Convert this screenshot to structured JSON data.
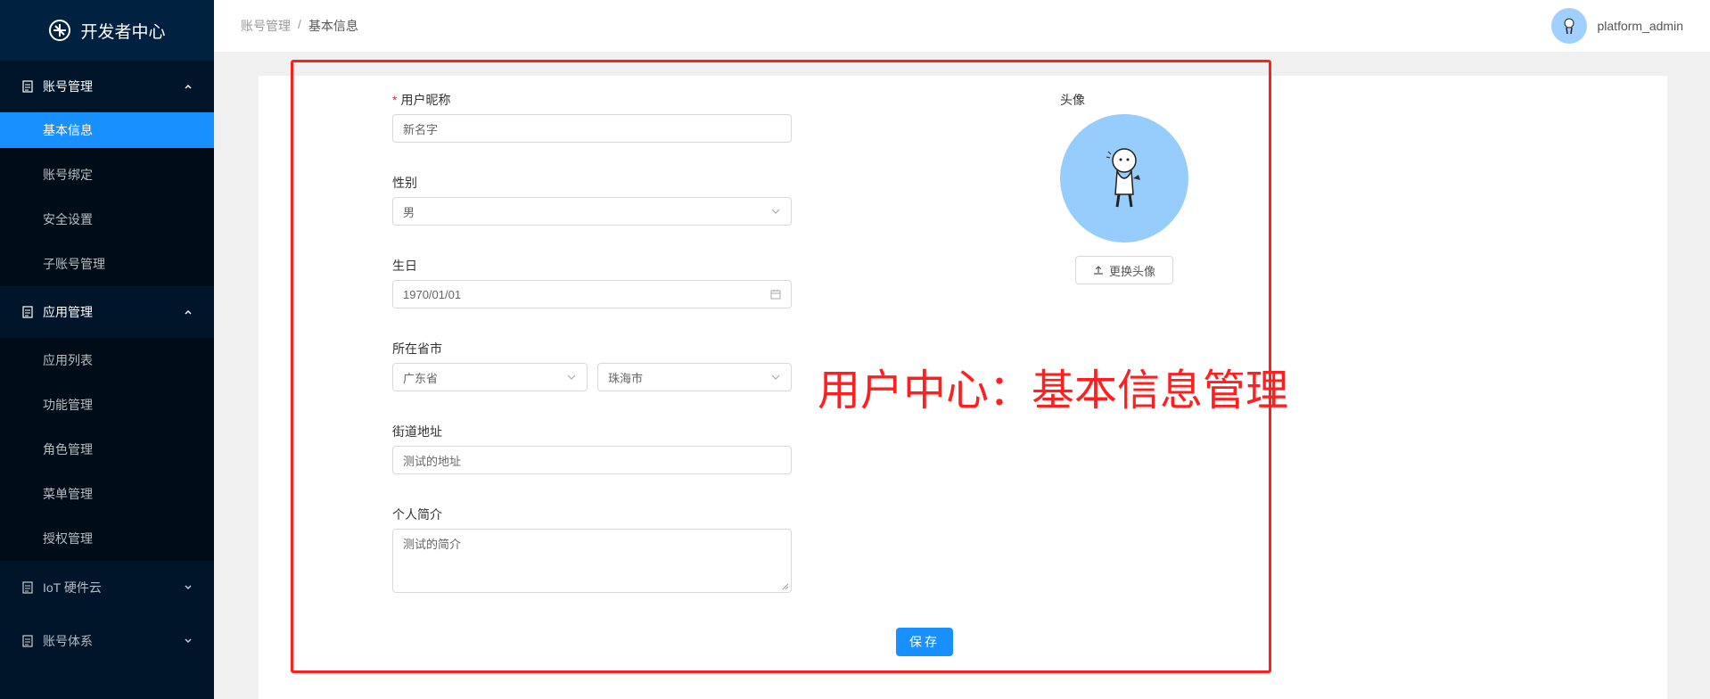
{
  "app": {
    "title": "开发者中心"
  },
  "sidebar": {
    "groups": [
      {
        "label": "账号管理",
        "expanded": true,
        "items": [
          {
            "label": "基本信息",
            "active": true
          },
          {
            "label": "账号绑定"
          },
          {
            "label": "安全设置"
          },
          {
            "label": "子账号管理"
          }
        ]
      },
      {
        "label": "应用管理",
        "expanded": true,
        "items": [
          {
            "label": "应用列表"
          },
          {
            "label": "功能管理"
          },
          {
            "label": "角色管理"
          },
          {
            "label": "菜单管理"
          },
          {
            "label": "授权管理"
          }
        ]
      },
      {
        "label": "IoT 硬件云",
        "expanded": false
      },
      {
        "label": "账号体系",
        "expanded": false
      }
    ]
  },
  "header": {
    "breadcrumb": [
      "账号管理",
      "基本信息"
    ],
    "separator": "/",
    "username": "platform_admin"
  },
  "form": {
    "nickname": {
      "label": "用户昵称",
      "required": true,
      "value": "新名字"
    },
    "gender": {
      "label": "性别",
      "value": "男"
    },
    "birthday": {
      "label": "生日",
      "value": "1970/01/01"
    },
    "region": {
      "label": "所在省市",
      "province": "广东省",
      "city": "珠海市"
    },
    "street": {
      "label": "街道地址",
      "value": "测试的地址"
    },
    "bio": {
      "label": "个人简介",
      "value": "测试的简介"
    },
    "avatar": {
      "label": "头像",
      "upload_label": "更换头像"
    },
    "save_label": "保存"
  },
  "annotation": {
    "text": "用户中心：基本信息管理",
    "color": "#ff1f1f"
  },
  "colors": {
    "sidebar_bg": "#001529",
    "accent": "#1890ff",
    "avatar_bg": "#97cdfd"
  }
}
